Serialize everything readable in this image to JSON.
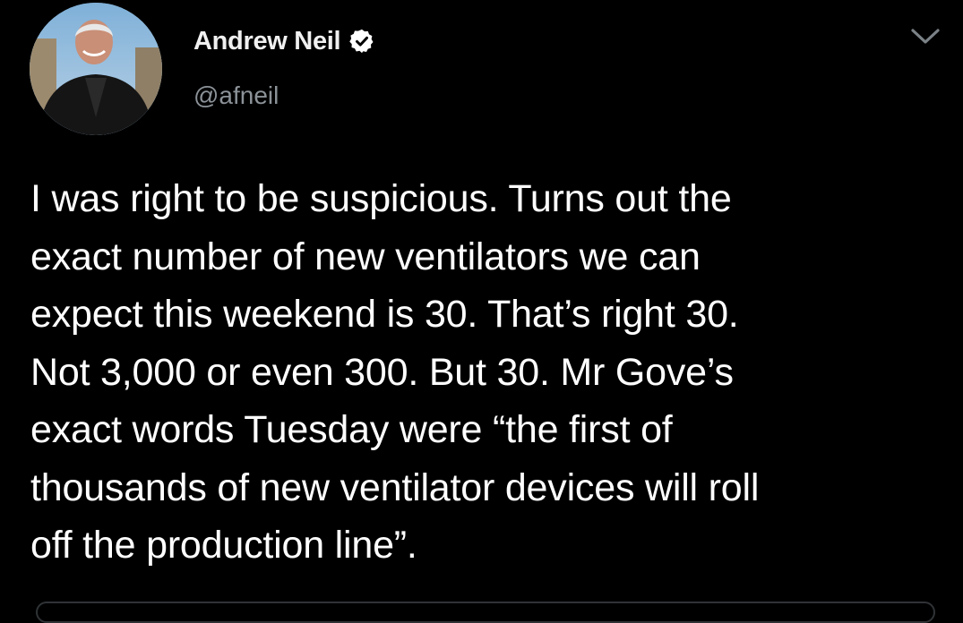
{
  "author": {
    "display_name": "Andrew Neil",
    "handle": "@afneil",
    "verified": true
  },
  "tweet": {
    "text": "I was right to be suspicious. Turns out the\nexact number of new ventilators we can\nexpect this weekend is 30. That’s right 30.\nNot 3,000 or even 300. But 30. Mr Gove’s\nexact words Tuesday were “the first of\nthousands of new ventilator devices will roll\noff the production line”."
  },
  "icons": {
    "verified": "verified-badge-icon",
    "menu": "chevron-down-icon"
  },
  "colors": {
    "background": "#000000",
    "text": "#ffffff",
    "secondary_text": "#8b9298",
    "verified_badge": "#ffffff"
  }
}
